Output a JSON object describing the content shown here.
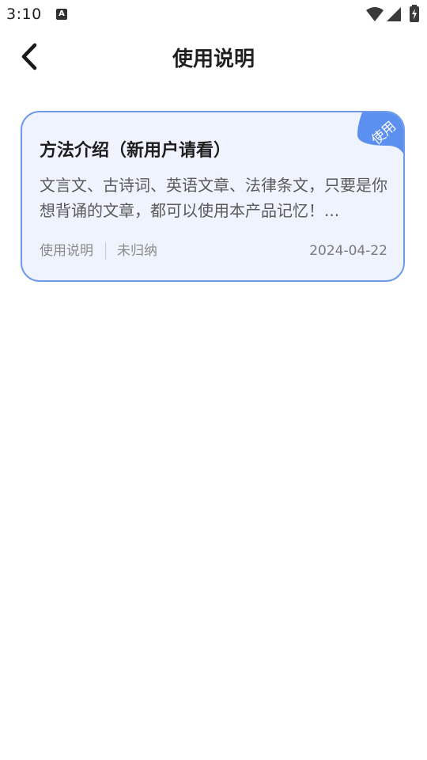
{
  "status_bar": {
    "time": "3:10",
    "notification_icon_letter": "A"
  },
  "header": {
    "title": "使用说明"
  },
  "cards": [
    {
      "ribbon_label": "使用",
      "title": "方法介绍（新用户请看）",
      "summary": "文言文、古诗词、英语文章、法律条文，只要是你想背诵的文章，都可以使用本产品记忆！...",
      "category": "使用说明",
      "status": "未归纳",
      "date": "2024-04-22"
    }
  ],
  "colors": {
    "card_border": "#6d9be9",
    "card_background": "#eef3fd",
    "ribbon": "#5b8ff0"
  }
}
